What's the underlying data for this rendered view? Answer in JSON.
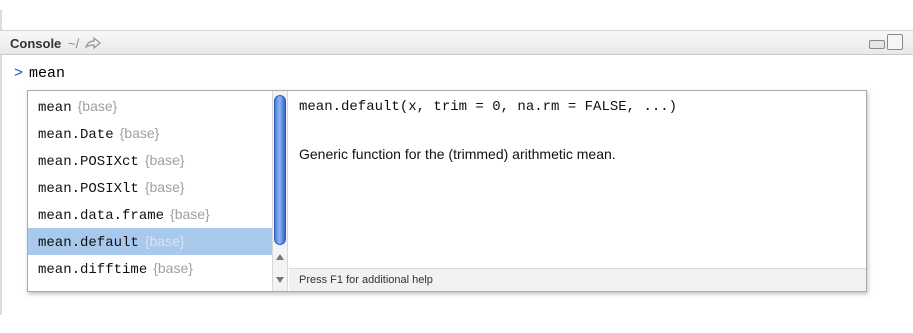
{
  "pane": {
    "title": "Console",
    "path": "~/",
    "navigate_icon": "arrow-icon",
    "minimize_icon": "minimize-icon",
    "maximize_icon": "maximize-icon"
  },
  "console": {
    "prompt": ">",
    "command": "mean"
  },
  "completions": {
    "items": [
      {
        "name": "mean",
        "package": "{base}",
        "selected": false
      },
      {
        "name": "mean.Date",
        "package": "{base}",
        "selected": false
      },
      {
        "name": "mean.POSIXct",
        "package": "{base}",
        "selected": false
      },
      {
        "name": "mean.POSIXlt",
        "package": "{base}",
        "selected": false
      },
      {
        "name": "mean.data.frame",
        "package": "{base}",
        "selected": false
      },
      {
        "name": "mean.default",
        "package": "{base}",
        "selected": true
      },
      {
        "name": "mean.difftime",
        "package": "{base}",
        "selected": false
      }
    ],
    "signature": "mean.default(x, trim = 0, na.rm = FALSE, ...)",
    "description": "Generic function for the (trimmed) arithmetic mean.",
    "help_hint": "Press F1 for additional help"
  },
  "colors": {
    "prompt": "#1a4cc2",
    "selection": "#a8c8ec",
    "package_text": "#a0a0a0",
    "scroll_thumb": "#4a7fd8"
  }
}
